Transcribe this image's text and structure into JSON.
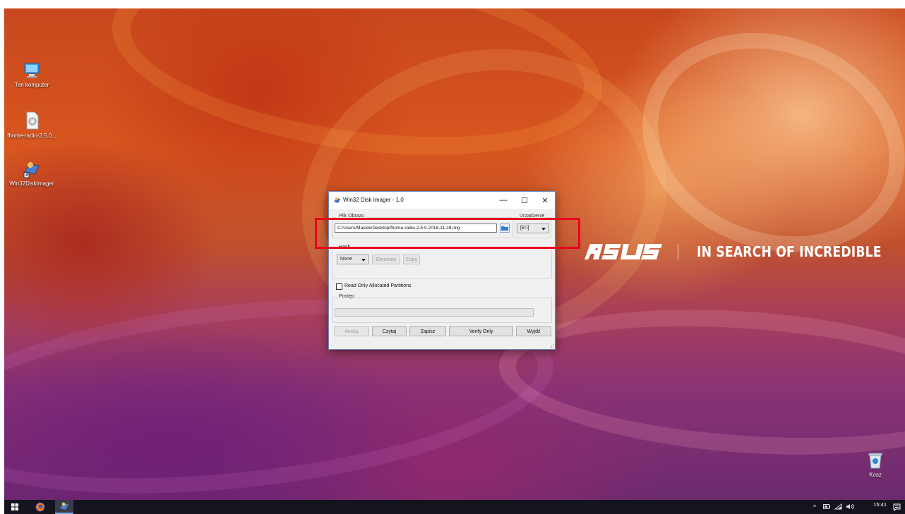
{
  "desktop": {
    "icons": [
      {
        "label": "Ten komputer",
        "icon": "computer-icon"
      },
      {
        "label": "fhome-radio-2.5.0...",
        "icon": "disk-image-file-icon"
      },
      {
        "label": "Win32DiskImager",
        "icon": "win32diskimager-shortcut-icon"
      }
    ],
    "recycle_bin": {
      "label": "Kosz",
      "icon": "recycle-bin-icon"
    },
    "brand": {
      "logo": "ASUS",
      "tagline": "IN SEARCH OF INCREDIBLE"
    }
  },
  "dialog": {
    "title": "Win32 Disk Imager - 1.0",
    "title_icon": "win32diskimager-app-icon",
    "controls": {
      "minimize": "—",
      "maximize": "☐",
      "close": "✕"
    },
    "image_file": {
      "label": "Plik Obrazu",
      "value": "C:/Users/Maciek/Desktop/fhome-radio-2.5.0-2018-11-28.img",
      "browse_icon": "folder-icon"
    },
    "device": {
      "label": "Urządzenie",
      "value": "[E:\\]"
    },
    "hash": {
      "label": "Hash",
      "selected": "None",
      "generate": "Generate",
      "copy": "Copy"
    },
    "read_only_allocated": {
      "label": "Read Only Allocated Partitions",
      "checked": false
    },
    "progress": {
      "label": "Postęp",
      "value": 0
    },
    "buttons": {
      "cancel": "Anuluj",
      "read": "Czytaj",
      "write": "Zapisz",
      "verify": "Verify Only",
      "exit": "Wyjdź"
    }
  },
  "highlight": {
    "color": "#e8001c"
  },
  "taskbar": {
    "pinned": [
      {
        "name": "start",
        "icon": "windows-start-icon"
      },
      {
        "name": "firefox",
        "icon": "firefox-icon"
      },
      {
        "name": "win32diskimager",
        "icon": "win32diskimager-taskbar-icon"
      }
    ],
    "tray": {
      "chevron": "^",
      "clock_time": "15:41",
      "icons": [
        "chevron-up-icon",
        "battery-icon",
        "wifi-icon",
        "volume-icon",
        "notifications-icon"
      ]
    }
  }
}
